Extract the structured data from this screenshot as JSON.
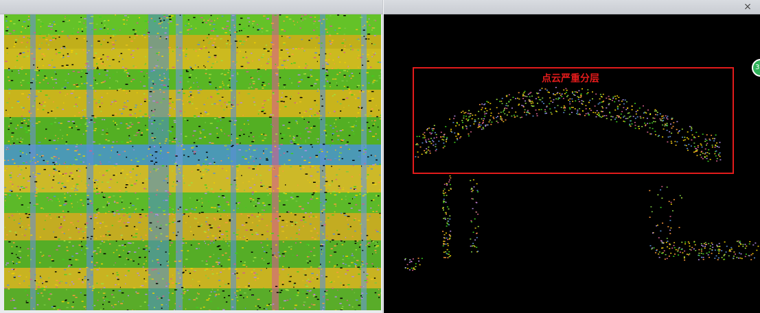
{
  "window": {
    "close_label": "×"
  },
  "right_view": {
    "annotation_text": "点云严重分层",
    "annotation_color": "#e31b1b",
    "badge_text": "3"
  },
  "colors": {
    "viewport_bg": "#000000",
    "point_palette": [
      "#7ac943",
      "#3cd11e",
      "#e8c21a",
      "#f0d000",
      "#5a8fd6",
      "#d45f8c",
      "#a0e040",
      "#ff9a3c",
      "#b28be6"
    ]
  }
}
